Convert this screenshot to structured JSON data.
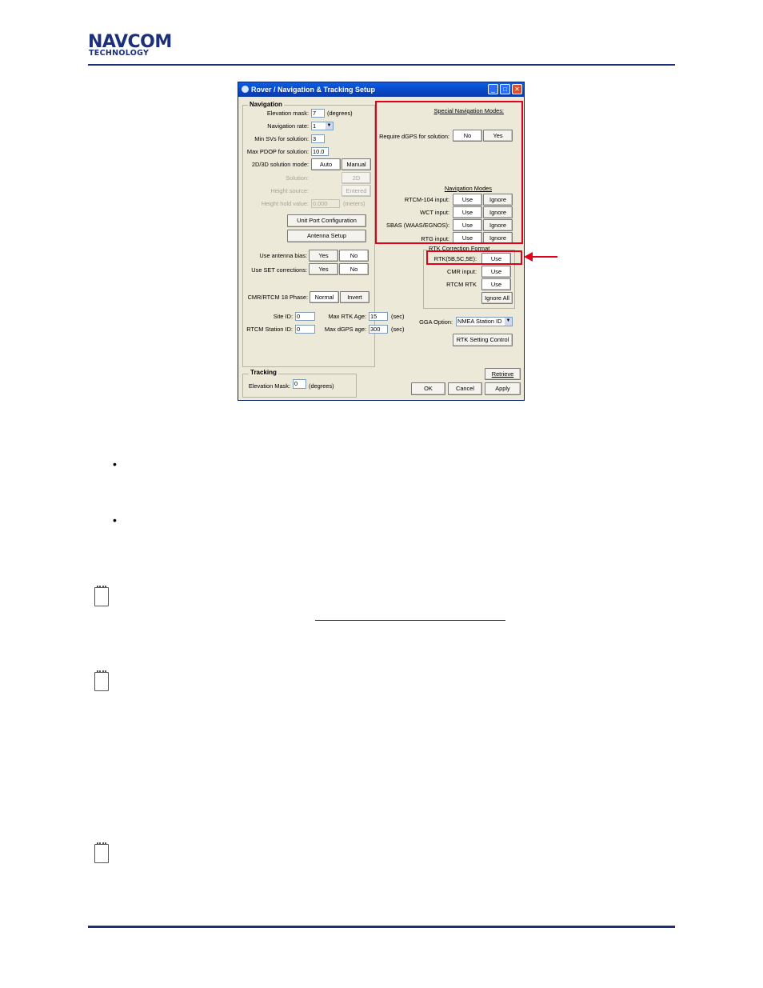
{
  "header": {
    "logo_top": "NAVCOM",
    "logo_bottom": "TECHNOLOGY"
  },
  "colors": {
    "brand_blue": "#1b2f7a",
    "highlight_red": "#e3001b",
    "titlebar_blue": "#0846c4",
    "window_bg": "#ece9d8"
  },
  "window": {
    "title": "Rover / Navigation & Tracking Setup",
    "icons": {
      "app": "satellite-icon",
      "minimize": "minimize-icon",
      "maximize": "maximize-icon",
      "close": "close-icon"
    },
    "minimize_glyph": "_",
    "maximize_glyph": "□",
    "close_glyph": "✕",
    "navigation": {
      "legend": "Navigation",
      "elevation_mask_label": "Elevation mask:",
      "elevation_mask_value": "7",
      "elevation_mask_unit": "(degrees)",
      "navigation_rate_label": "Navigation rate:",
      "navigation_rate_value": "1",
      "min_svs_label": "Min SVs for solution:",
      "min_svs_value": "3",
      "max_pdop_label": "Max PDOP for solution:",
      "max_pdop_value": "10.0",
      "solution_mode_label": "2D/3D solution mode:",
      "auto": "Auto",
      "manual": "Manual",
      "solution_label": "Solution:",
      "solution_value": "2D",
      "height_source_label": "Height source:",
      "height_source_value": "Entered",
      "height_hold_label": "Height hold value:",
      "height_hold_value": "0.000",
      "height_hold_unit": "(meters)",
      "unit_port_button": "Unit Port Configuration",
      "antenna_setup_button": "Antenna Setup",
      "use_antenna_bias_label": "Use antenna bias:",
      "use_set_corrections_label": "Use SET corrections:",
      "yes": "Yes",
      "no": "No",
      "cmr_phase_label": "CMR/RTCM 18 Phase:",
      "normal": "Normal",
      "invert": "Invert",
      "site_id_label": "Site ID:",
      "site_id_value": "0",
      "rtcm_station_id_label": "RTCM Station ID:",
      "rtcm_station_id_value": "0",
      "max_rtk_age_label": "Max RTK Age:",
      "max_rtk_age_value": "15",
      "sec": "(sec)",
      "max_dgps_age_label": "Max dGPS age:",
      "max_dgps_age_value": "300"
    },
    "special": {
      "title": "Special Navigation Modes:",
      "require_dgps_label": "Require dGPS for solution:",
      "no": "No",
      "yes": "Yes",
      "nav_modes_title": "Navigation Modes",
      "use": "Use",
      "ignore": "Ignore",
      "rows": [
        "RTCM-104 input:",
        "WCT input:",
        "SBAS (WAAS/EGNOS):",
        "RTG input:"
      ]
    },
    "rtk": {
      "legend": "RTK Correction Format",
      "rtk_label": "RTK(5B,5C,5E):",
      "cmr_label": "CMR input:",
      "rtcm_rtk_label": "RTCM RTK",
      "use": "Use",
      "ignore_all": "Ignore All",
      "gga_option_label": "GGA Option:",
      "gga_option_value": "NMEA Station ID",
      "rtk_setting_button": "RTK Setting Control"
    },
    "tracking": {
      "legend": "Tracking",
      "elevation_mask_label": "Elevation Mask:",
      "elevation_mask_value": "0",
      "unit": "(degrees)"
    },
    "buttons": {
      "retrieve": "Retrieve",
      "ok": "OK",
      "cancel": "Cancel",
      "apply": "Apply"
    }
  },
  "notes": {
    "icon": "note-icon"
  }
}
